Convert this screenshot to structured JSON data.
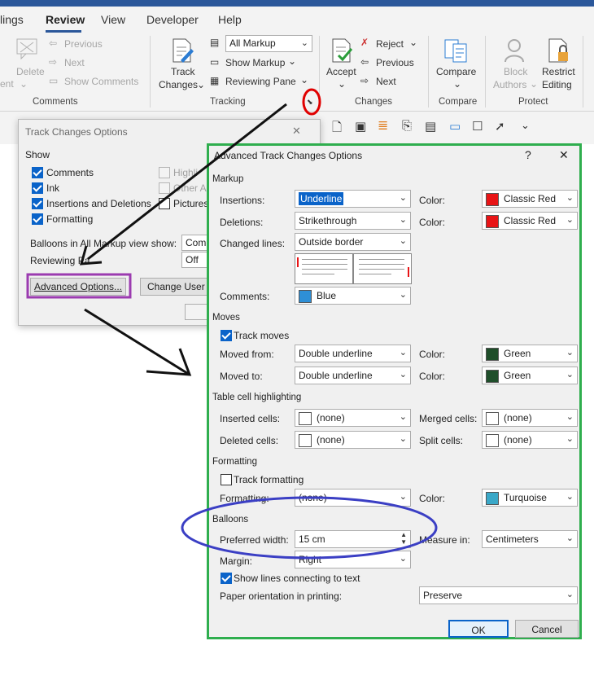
{
  "ribbon": {
    "tabs": [
      "lings",
      "Review",
      "View",
      "Developer",
      "Help"
    ],
    "comments": {
      "delete": "Delete",
      "previous": "Previous",
      "next": "Next",
      "show_comments": "Show Comments",
      "ent": "ent",
      "group": "Comments"
    },
    "tracking": {
      "track_changes_line1": "Track",
      "track_changes_line2": "Changes",
      "markup_value": "All Markup",
      "show_markup": "Show Markup",
      "reviewing_pane": "Reviewing Pane",
      "group": "Tracking"
    },
    "changes": {
      "accept": "Accept",
      "reject": "Reject",
      "previous": "Previous",
      "next": "Next",
      "group": "Changes"
    },
    "compare": {
      "compare": "Compare",
      "group": "Compare"
    },
    "protect": {
      "block_line1": "Block",
      "block_line2": "Authors",
      "restrict_line1": "Restrict",
      "restrict_line2": "Editing",
      "group": "Protect"
    }
  },
  "tco": {
    "title": "Track Changes Options",
    "show_label": "Show",
    "comments": "Comments",
    "ink": "Ink",
    "insertions_deletions": "Insertions and Deletions",
    "formatting": "Formatting",
    "highlight": "Highli",
    "other": "Other A",
    "pictures": "Pictures",
    "balloons_label": "Balloons in All Markup view show:",
    "balloons_value": "Comm",
    "reviewing_label": "Reviewing Pa",
    "reviewing_value": "Off",
    "advanced_button": "Advanced Options...",
    "change_user_button": "Change User N",
    "close": "✕"
  },
  "adv": {
    "title": "Advanced Track Changes Options",
    "help": "?",
    "close": "✕",
    "markup": {
      "section": "Markup",
      "insertions_label": "Insertions:",
      "insertions_value": "Underline",
      "deletions_label": "Deletions:",
      "deletions_value": "Strikethrough",
      "changed_lines_label": "Changed lines:",
      "changed_lines_value": "Outside border",
      "comments_label": "Comments:",
      "comments_value": "Blue",
      "color_label": "Color:",
      "ins_color": "Classic Red",
      "del_color": "Classic Red"
    },
    "moves": {
      "section": "Moves",
      "track_moves": "Track moves",
      "moved_from_label": "Moved from:",
      "moved_from_value": "Double underline",
      "moved_to_label": "Moved to:",
      "moved_to_value": "Double underline",
      "color_label": "Color:",
      "from_color": "Green",
      "to_color": "Green"
    },
    "table": {
      "section": "Table cell highlighting",
      "inserted_label": "Inserted cells:",
      "inserted_value": "(none)",
      "deleted_label": "Deleted cells:",
      "deleted_value": "(none)",
      "merged_label": "Merged cells:",
      "merged_value": "(none)",
      "split_label": "Split cells:",
      "split_value": "(none)"
    },
    "formatting": {
      "section": "Formatting",
      "track_formatting": "Track formatting",
      "formatting_label": "Formatting:",
      "formatting_value": "(none)",
      "color_label": "Color:",
      "color_value": "Turquoise"
    },
    "balloons": {
      "section": "Balloons",
      "preferred_width_label": "Preferred width:",
      "preferred_width_value": "15 cm",
      "measure_label": "Measure in:",
      "measure_value": "Centimeters",
      "margin_label": "Margin:",
      "margin_value": "Right",
      "show_lines": "Show lines connecting to text",
      "paper_label": "Paper orientation in printing:",
      "paper_value": "Preserve"
    },
    "ok": "OK",
    "cancel": "Cancel"
  },
  "colors": {
    "classic_red": "#e81416",
    "green": "#1f4e2a",
    "blue": "#2e8fd6",
    "turquoise": "#3aa8c8",
    "accent": "#2b579a",
    "green_border": "#2fae4e",
    "purple": "#9b3bb0",
    "ellipse": "#3b3fc4",
    "red_circle": "#e00000"
  }
}
